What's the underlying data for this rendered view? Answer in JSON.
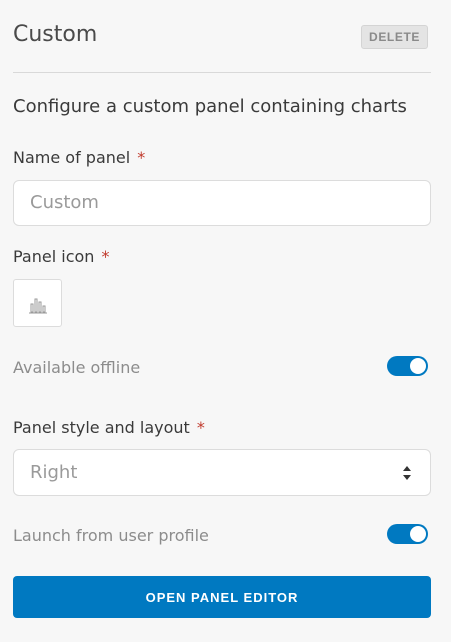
{
  "header": {
    "title": "Custom",
    "delete_label": "DELETE"
  },
  "description": "Configure a custom panel containing charts",
  "name_field": {
    "label": "Name of panel",
    "required_marker": "*",
    "value": "Custom"
  },
  "icon_field": {
    "label": "Panel icon",
    "required_marker": "*",
    "icon": "bar-chart-icon"
  },
  "offline_toggle": {
    "label": "Available offline",
    "on": true
  },
  "style_field": {
    "label": "Panel style and layout",
    "required_marker": "*",
    "selected": "Right"
  },
  "profile_toggle": {
    "label": "Launch from user profile",
    "on": true
  },
  "editor_button": {
    "label": "OPEN PANEL EDITOR"
  },
  "colors": {
    "accent": "#0079c1",
    "required": "#c0392b",
    "background": "#f7f7f7"
  }
}
